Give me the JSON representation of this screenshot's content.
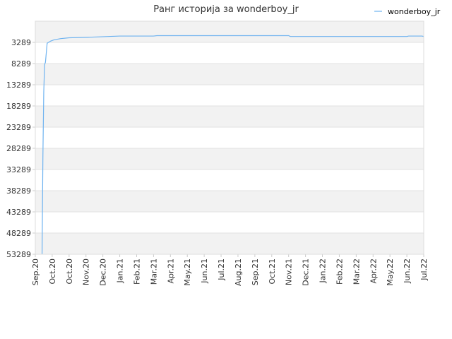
{
  "chart_data": {
    "type": "line",
    "title": "Ранг историја за wonderboy_jr",
    "xlabel": "",
    "ylabel": "",
    "y_inverted": true,
    "ylim": [
      53289,
      -1711
    ],
    "y_ticks": [
      3289,
      8289,
      13289,
      18289,
      23289,
      28289,
      33289,
      38289,
      43289,
      48289,
      53289
    ],
    "x_ticks": [
      "Sep.20",
      "Oct.20",
      "Oct.20",
      "Nov.20",
      "Dec.20",
      "Jan.21",
      "Feb.21",
      "Mar.21",
      "Apr.21",
      "May.21",
      "Jun.21",
      "Jul.21",
      "Aug.21",
      "Sep.21",
      "Oct.21",
      "Nov.21",
      "Dec.21",
      "Jan.22",
      "Feb.22",
      "Mar.22",
      "Apr.22",
      "May.22",
      "Jun.22",
      "Jul.22"
    ],
    "grid": true,
    "legend_position": "top-right",
    "series": [
      {
        "name": "wonderboy_jr",
        "color": "#6fb3f0",
        "x": [
          0.4,
          0.45,
          0.5,
          0.55,
          0.6,
          0.7,
          0.9,
          1.1,
          1.5,
          2.0,
          3.0,
          5.0,
          7.0,
          7.2,
          15.0,
          15.1,
          22.0,
          22.1,
          22.9,
          23.0
        ],
        "y": [
          53289,
          30000,
          15000,
          8500,
          8000,
          3500,
          3000,
          2700,
          2400,
          2200,
          2100,
          1800,
          1800,
          1700,
          1700,
          1900,
          1900,
          1800,
          1800,
          1900
        ]
      }
    ]
  }
}
